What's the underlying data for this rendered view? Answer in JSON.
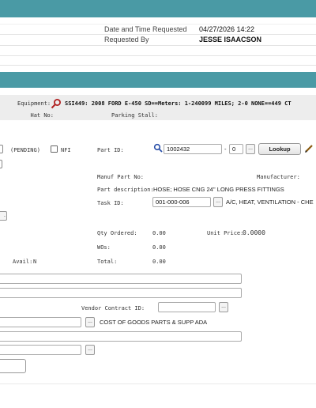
{
  "header": {
    "date_label": "Date and Time Requested",
    "date_value": "04/27/2026 14:22",
    "requested_by_label": "Requested By",
    "requested_by_value": "JESSE ISAACSON"
  },
  "equipment": {
    "label": "Equipment:",
    "value": "SSI449: 2008 FORD E-450 SD==Meters: 1-240099 MILES; 2-0 NONE==449 CT",
    "hat_no_label": "Hat No:",
    "parking_stall_label": "Parking Stall:"
  },
  "status": {
    "pending": "(PENDING)",
    "nfi_label": "NFI",
    "avail_label": "Avail:",
    "avail_value": "N"
  },
  "part": {
    "part_id_label": "Part ID:",
    "part_id_value": "1002432",
    "part_suffix_value": "0",
    "ellipsis": "...",
    "lookup_label": "Lookup",
    "manuf_part_label": "Manuf Part No:",
    "manufacturer_label": "Manufacturer:",
    "description_label": "Part description:",
    "description_value": "HOSE; HOSE CNG 24'' LONG PRESS FITTINGS",
    "task_id_label": "Task ID:",
    "task_id_value": "001-000-006",
    "task_desc": "A/C, HEAT, VENTILATION - CHE",
    "qty_label": "Qty Ordered:",
    "qty_value": "0.00",
    "unit_price_label": "Unit Price:",
    "unit_price_value": "0.0000",
    "wos_label": "WOs:",
    "wos_value": "0.00",
    "total_label": "Total:",
    "total_value": "0.00"
  },
  "vendor": {
    "contract_label": "Vendor Contract ID:",
    "account_desc": "COST OF GOODS PARTS & SUPP ADA"
  },
  "colors": {
    "teal": "#4a9aa5",
    "search_icon": "#2a4fa8",
    "equipment_search_icon": "#b02020"
  }
}
